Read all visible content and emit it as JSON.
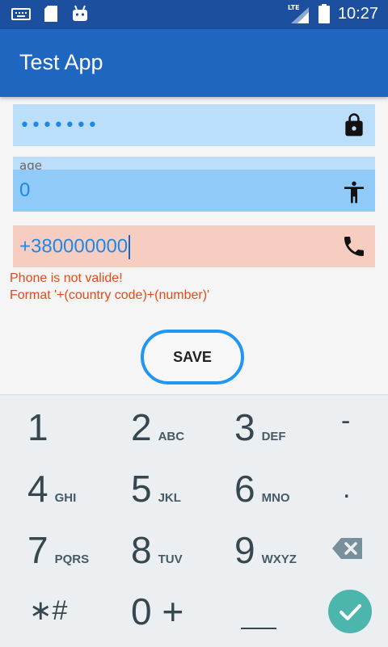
{
  "status_bar": {
    "network": "LTE",
    "time": "10:27",
    "icons": [
      "keyboard-icon",
      "sd-card-icon",
      "android-icon",
      "lte-signal-icon",
      "battery-icon"
    ]
  },
  "app_bar": {
    "title": "Test App"
  },
  "form": {
    "password": {
      "masked_value": "•••••••",
      "icon": "lock-icon"
    },
    "age": {
      "label": "age",
      "value": "0",
      "icon": "person-icon"
    },
    "phone": {
      "value": "+380000000",
      "icon": "phone-icon"
    },
    "error": {
      "line1": "Phone is not valide!",
      "line2": "Format '+(country code)+(number)'"
    },
    "save_label": "SAVE"
  },
  "keypad": {
    "keys": [
      {
        "num": "1",
        "letters": ""
      },
      {
        "num": "2",
        "letters": "ABC"
      },
      {
        "num": "3",
        "letters": "DEF"
      },
      {
        "num": "-",
        "letters": ""
      },
      {
        "num": "4",
        "letters": "GHI"
      },
      {
        "num": "5",
        "letters": "JKL"
      },
      {
        "num": "6",
        "letters": "MNO"
      },
      {
        "num": ".",
        "letters": ""
      },
      {
        "num": "7",
        "letters": "PQRS"
      },
      {
        "num": "8",
        "letters": "TUV"
      },
      {
        "num": "9",
        "letters": "WXYZ"
      },
      {
        "num": "⌫",
        "letters": ""
      },
      {
        "num": "∗#",
        "letters": ""
      },
      {
        "num": "0 +",
        "letters": ""
      },
      {
        "num": "_",
        "letters": ""
      },
      {
        "num": "✓",
        "letters": ""
      }
    ]
  },
  "colors": {
    "status_bar": "#1c4f9e",
    "app_bar": "#1e66bf",
    "field_bg": "#bbdefa",
    "field_focus_bg": "#90caf9",
    "error_field_bg": "#f7cdc2",
    "error_text": "#e64a19",
    "accent": "#2196f3",
    "enter_key": "#4db6ac"
  }
}
